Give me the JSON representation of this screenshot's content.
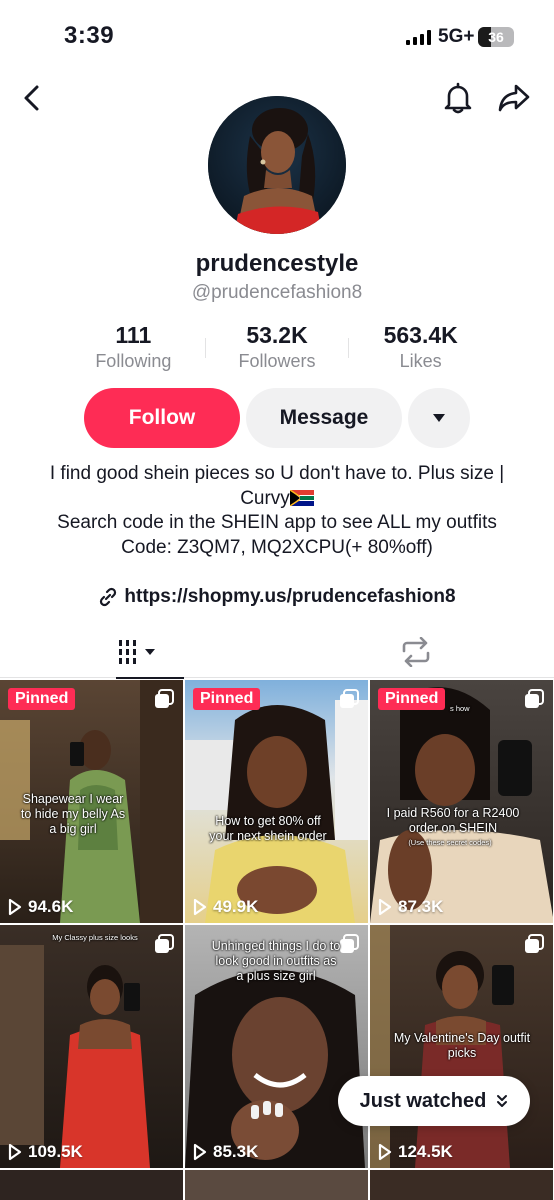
{
  "status_bar": {
    "time": "3:39",
    "network": "5G+",
    "battery": "36",
    "battery_level": 0.36
  },
  "nav": {
    "back_icon": "chevron-left-icon",
    "bell_icon": "bell-icon",
    "share_icon": "share-arrow-icon"
  },
  "profile": {
    "username": "prudencestyle",
    "handle": "@prudencefashion8",
    "stats": [
      {
        "value": "111",
        "label": "Following"
      },
      {
        "value": "53.2K",
        "label": "Followers"
      },
      {
        "value": "563.4K",
        "label": "Likes"
      }
    ]
  },
  "actions": {
    "follow_label": "Follow",
    "message_label": "Message",
    "more_icon": "caret-down-icon"
  },
  "bio": {
    "line1": "I find good shein pieces so U don't have to. Plus size | Curvy",
    "line2": "Search code in the SHEIN app to see ALL my outfits",
    "line3": "Code: Z3QM7, MQ2XCPU(+ 80%off)",
    "link": "https://shopmy.us/prudencefashion8"
  },
  "tabs": {
    "videos_icon": "grid-icon",
    "reposts_icon": "repost-icon"
  },
  "videos": [
    {
      "pinned": "Pinned",
      "caption": "Shapewear I wear to hide my belly As a big girl",
      "views": "94.6K",
      "bg": [
        "#4a3a2e",
        "#2a2018"
      ]
    },
    {
      "pinned": "Pinned",
      "caption": "How to get 80% off your next shein order",
      "views": "49.9K",
      "bg": [
        "#8fb6d9",
        "#e8d39a"
      ]
    },
    {
      "pinned": "Pinned",
      "caption_top": "s how",
      "caption": "I paid R560 for a R2400 order on SHEIN",
      "caption_sub": "(Use these secret codes)",
      "views": "87.3K",
      "bg": [
        "#3a3432",
        "#c9b8a0"
      ]
    },
    {
      "caption_top": "My Classy plus size looks",
      "views": "109.5K",
      "bg": [
        "#2b2420",
        "#a8322c"
      ]
    },
    {
      "caption": "Unhinged things I do to look good in outfits as a plus size girl",
      "views": "85.3K",
      "bg": [
        "#9a9a9a",
        "#4a3a30"
      ]
    },
    {
      "caption": "My Valentine's Day outfit picks",
      "views": "124.5K",
      "bg": [
        "#3a2c24",
        "#7a2a28"
      ]
    }
  ],
  "pinned_label": "Pinned",
  "just_watched": {
    "label": "Just watched"
  }
}
